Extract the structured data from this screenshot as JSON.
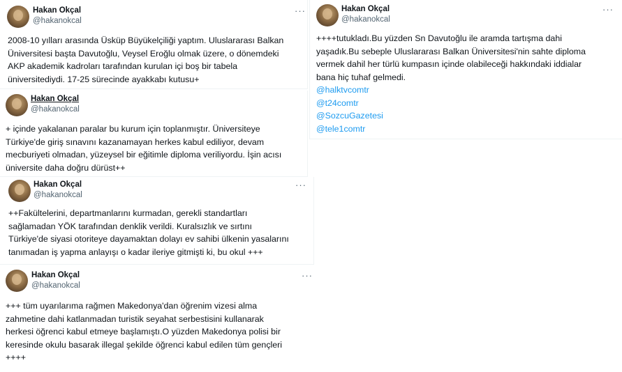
{
  "author": {
    "name": "Hakan Okçal",
    "handle": "@hakanokcal"
  },
  "more_icon": "more-horizontal-icon",
  "colors": {
    "link": "#1d9bf0",
    "text": "#0f1419",
    "muted": "#536471",
    "divider": "#eff3f4"
  },
  "tweets": [
    {
      "lines": [
        "2008-10 yılları arasında Üsküp Büyükelçiliği yaptım. Uluslararası Balkan",
        "Üniversitesi başta Davutoğlu, Veysel Eroğlu olmak üzere, o dönemdeki",
        "AKP akademik kadroları tarafından kurulan içi boş bir tabela",
        "üniversitediydi. 17-25 sürecinde ayakkabı kutusu+"
      ]
    },
    {
      "lines": [
        "+ içinde yakalanan paralar bu kurum için toplanmıştır. Üniversiteye",
        "Türkiye'de giriş sınavını kazanamayan herkes kabul ediliyor, devam",
        "mecburiyeti olmadan, yüzeysel bir eğitimle diploma veriliyordu. İşin acısı",
        "üniversite daha doğru dürüst++"
      ]
    },
    {
      "lines": [
        "++Fakültelerini, departmanlarını   kurmadan, gerekli standartları",
        "sağlamadan YÖK tarafından denklik verildi. Kuralsızlık ve sırtını",
        "Türkiye'de siyasi otoriteye dayamaktan dolayı ev sahibi ülkenin yasalarını",
        "tanımadan iş yapma anlayışı o kadar ileriye gitmişti ki, bu okul +++"
      ]
    },
    {
      "lines": [
        "+++ tüm uyarılarıma rağmen Makedonya'dan öğrenim vizesi alma",
        "zahmetine dahi katlanmadan turistik seyahat serbestisini kullanarak",
        "herkesi öğrenci kabul etmeye başlamıştı.O yüzden Makedonya polisi bir",
        "keresinde okulu basarak illegal şekilde öğrenci kabul edilen tüm gençleri",
        "++++"
      ]
    },
    {
      "lines": [
        "++++tutukladı.Bu yüzden Sn Davutoğlu ile aramda tartışma dahi",
        "yaşadık.Bu sebeple Uluslararası Balkan Üniversitesi'nin sahte diploma",
        "vermek dahil her türlü kumpasın içinde olabileceği hakkındaki iddialar",
        "bana hiç tuhaf gelmedi."
      ],
      "mentions": [
        "@halktvcomtr",
        "@t24comtr",
        "@SozcuGazetesi",
        "@tele1comtr"
      ]
    }
  ]
}
